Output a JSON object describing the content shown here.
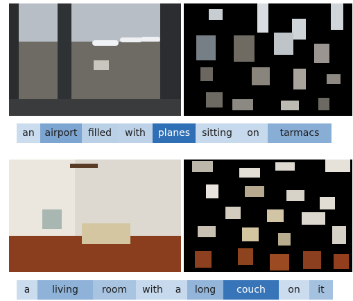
{
  "figure": {
    "rows": [
      {
        "caption": [
          {
            "text": "an",
            "weight": 0.1
          },
          {
            "text": "airport",
            "weight": 0.55
          },
          {
            "text": "filled",
            "weight": 0.2
          },
          {
            "text": "with",
            "weight": 0.18
          },
          {
            "text": "planes",
            "weight": 1.0
          },
          {
            "text": "sitting",
            "weight": 0.12
          },
          {
            "text": "on",
            "weight": 0.12
          },
          {
            "text": "tarmacs",
            "weight": 0.48
          }
        ]
      },
      {
        "caption": [
          {
            "text": "a",
            "weight": 0.1
          },
          {
            "text": "living",
            "weight": 0.45
          },
          {
            "text": "room",
            "weight": 0.3
          },
          {
            "text": "with",
            "weight": 0.12
          },
          {
            "text": "a",
            "weight": 0.12
          },
          {
            "text": "long",
            "weight": 0.42
          },
          {
            "text": "couch",
            "weight": 0.95
          },
          {
            "text": "on",
            "weight": 0.1
          },
          {
            "text": "it",
            "weight": 0.32
          }
        ]
      }
    ],
    "colors": {
      "text": "#1b1b1b",
      "low": "#dce8f4",
      "high": "#2f6fb5"
    }
  }
}
